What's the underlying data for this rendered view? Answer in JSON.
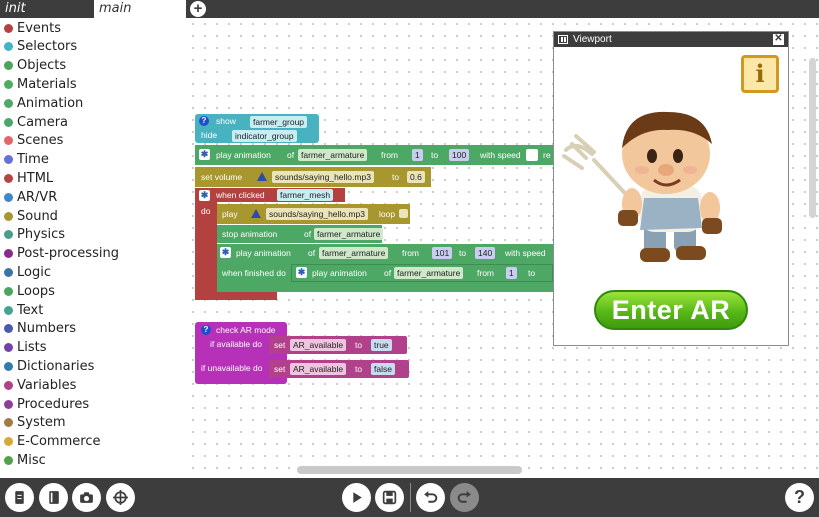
{
  "tabs": {
    "init": "init",
    "main": "main",
    "add_icon": "plus-icon"
  },
  "categories": [
    {
      "label": "Events",
      "color": "#b3413f"
    },
    {
      "label": "Selectors",
      "color": "#43b4c4"
    },
    {
      "label": "Objects",
      "color": "#49a657"
    },
    {
      "label": "Materials",
      "color": "#4eab5f"
    },
    {
      "label": "Animation",
      "color": "#52a868"
    },
    {
      "label": "Camera",
      "color": "#4ba66a"
    },
    {
      "label": "Scenes",
      "color": "#e1666a"
    },
    {
      "label": "Time",
      "color": "#6a6ed8"
    },
    {
      "label": "HTML",
      "color": "#b54545"
    },
    {
      "label": "AR/VR",
      "color": "#3e88c8"
    },
    {
      "label": "Sound",
      "color": "#a8962f"
    },
    {
      "label": "Physics",
      "color": "#4a9d8a"
    },
    {
      "label": "Post-processing",
      "color": "#8a2b8c"
    },
    {
      "label": "Logic",
      "color": "#3c74a8"
    },
    {
      "label": "Loops",
      "color": "#4ca55c"
    },
    {
      "label": "Text",
      "color": "#46a392"
    },
    {
      "label": "Numbers",
      "color": "#4a5aab"
    },
    {
      "label": "Lists",
      "color": "#7143a6"
    },
    {
      "label": "Dictionaries",
      "color": "#2e7daa"
    },
    {
      "label": "Variables",
      "color": "#b0418a"
    },
    {
      "label": "Procedures",
      "color": "#8d3e9a"
    },
    {
      "label": "System",
      "color": "#a57a45"
    },
    {
      "label": "E-Commerce",
      "color": "#d9a934"
    },
    {
      "label": "Misc",
      "color": "#55a04b"
    }
  ],
  "blocks": {
    "show_label": "show",
    "show_target": "farmer_group",
    "hide_label": "hide",
    "hide_target": "indicator_group",
    "play_anim_label": "play animation",
    "of_label": "of",
    "anim_target": "farmer_armature",
    "from_label": "from",
    "from_value": "1",
    "to_label": "to",
    "to_value": "100",
    "speed_label": "with speed",
    "speed_cut": "re",
    "set_volume_label": "set volume",
    "volume_sound": "sounds/saying_hello.mp3",
    "volume_value": "0.6",
    "when_clicked_label": "when clicked",
    "clicked_target": "farmer_mesh",
    "do_label": "do",
    "play_label": "play",
    "play_sound": "sounds/saying_hello.mp3",
    "loop_label": "loop",
    "stop_anim_label": "stop animation",
    "stop_target": "farmer_armature",
    "play_anim2_label": "play animation",
    "anim2_target": "farmer_armature",
    "anim2_from": "101",
    "anim2_to": "140",
    "anim2_speed": "with speed",
    "when_finished_label": "when finished do",
    "play_anim3_label": "play animation",
    "anim3_target": "farmer_armature",
    "anim3_from": "1",
    "check_ar_label": "check AR mode",
    "if_available_label": "if available do",
    "if_unavailable_label": "if unavailable do",
    "set_label": "set",
    "var_name": "AR_available",
    "true_value": "true",
    "false_value": "false"
  },
  "viewport": {
    "title": "Viewport",
    "close_icon": "close-icon",
    "info_label": "i",
    "enter_ar_label": "Enter AR"
  },
  "toolbar": {
    "left": [
      "book-icon",
      "notebook-icon",
      "camera-icon",
      "crosshair-icon"
    ],
    "center": [
      "play-icon",
      "save-icon",
      "undo-icon",
      "redo-icon"
    ],
    "help_label": "?"
  }
}
